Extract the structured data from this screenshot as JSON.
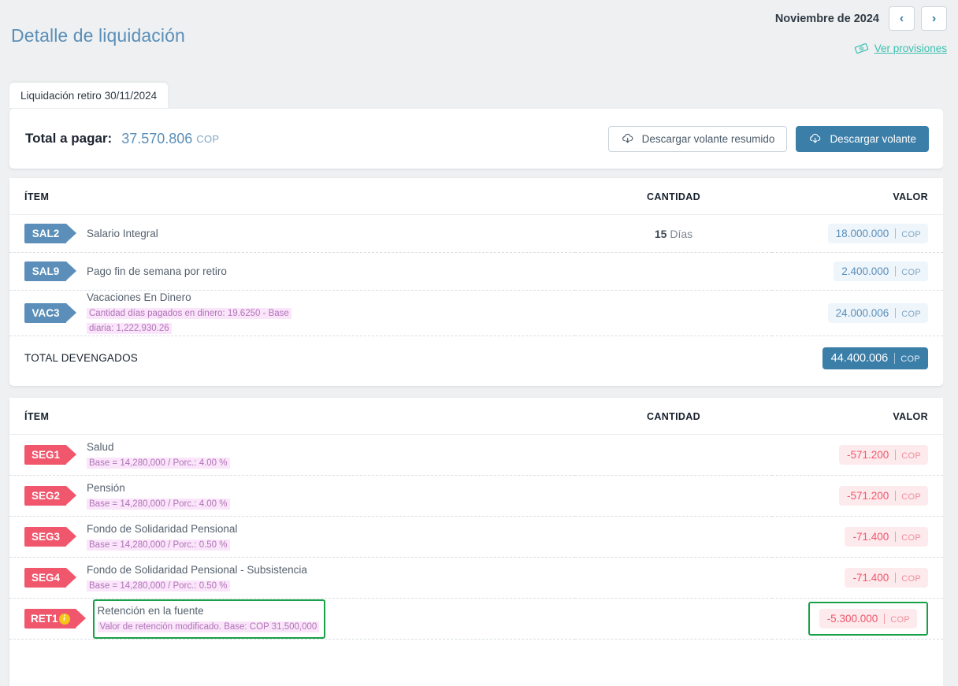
{
  "header": {
    "title": "Detalle de liquidación",
    "month_label": "Noviembre de 2024",
    "prev_icon": "chevron-left-icon",
    "next_icon": "chevron-right-icon",
    "prev_glyph": "‹",
    "next_glyph": "›",
    "provisions_link": "Ver provisiones",
    "provisions_icon": "banknote-icon",
    "accent_title": "#5b8fb9",
    "accent_link": "#3bbfb0"
  },
  "tabs": [
    {
      "label": "Liquidación retiro 30/11/2024",
      "active": true
    }
  ],
  "summary": {
    "total_label": "Total a pagar:",
    "total_value": "37.570.806",
    "currency": "COP",
    "buttons": [
      {
        "label": "Descargar volante resumido",
        "icon": "cloud-download-icon",
        "style": "ghost"
      },
      {
        "label": "Descargar volante",
        "icon": "cloud-download-icon",
        "style": "solid"
      }
    ]
  },
  "columns": {
    "item": "ÍTEM",
    "qty": "CANTIDAD",
    "value": "VALOR"
  },
  "earnings": {
    "rows": [
      {
        "code": "SAL2",
        "name": "Salario Integral",
        "sub": "",
        "qty_number": "15",
        "qty_unit": "Días",
        "value": "18.000.000",
        "currency": "COP",
        "sign": "pos"
      },
      {
        "code": "SAL9",
        "name": "Pago fin de semana por retiro",
        "sub": "",
        "qty_number": "",
        "qty_unit": "",
        "value": "2.400.000",
        "currency": "COP",
        "sign": "pos"
      },
      {
        "code": "VAC3",
        "name": "Vacaciones En Dinero",
        "sub": "Cantidad días pagados en dinero: 19.6250 - Base diaria: 1,222,930.26",
        "qty_number": "",
        "qty_unit": "",
        "value": "24.000.006",
        "currency": "COP",
        "sign": "pos"
      }
    ],
    "total_label": "TOTAL DEVENGADOS",
    "total_value": "44.400.006",
    "total_currency": "COP"
  },
  "deductions": {
    "rows": [
      {
        "code": "SEG1",
        "name": "Salud",
        "sub": "Base = 14,280,000 / Porc.: 4.00 %",
        "qty_number": "",
        "qty_unit": "",
        "value": "-571.200",
        "currency": "COP",
        "sign": "neg",
        "highlight": false
      },
      {
        "code": "SEG2",
        "name": "Pensión",
        "sub": "Base = 14,280,000 / Porc.: 4.00 %",
        "qty_number": "",
        "qty_unit": "",
        "value": "-571.200",
        "currency": "COP",
        "sign": "neg",
        "highlight": false
      },
      {
        "code": "SEG3",
        "name": "Fondo de Solidaridad Pensional",
        "sub": "Base = 14,280,000 / Porc.: 0.50 %",
        "qty_number": "",
        "qty_unit": "",
        "value": "-71.400",
        "currency": "COP",
        "sign": "neg",
        "highlight": false
      },
      {
        "code": "SEG4",
        "name": "Fondo de Solidaridad Pensional - Subsistencia",
        "sub": "Base = 14,280,000 / Porc.: 0.50 %",
        "qty_number": "",
        "qty_unit": "",
        "value": "-71.400",
        "currency": "COP",
        "sign": "neg",
        "highlight": false
      },
      {
        "code": "RET1",
        "name": "Retención en la fuente",
        "sub": "Valor de retención modificado. Base: COP 31,500,000",
        "badge": "i",
        "badge_icon": "info-badge-icon",
        "qty_number": "",
        "qty_unit": "",
        "value": "-5.300.000",
        "currency": "COP",
        "sign": "neg",
        "highlight": true
      }
    ]
  },
  "colors": {
    "tag_blue": "#5b8fb9",
    "tag_red": "#f0576d",
    "highlight_green": "#18a04a",
    "badge_yellow": "#f5c518",
    "sub_highlight": "#fae5fa",
    "page_bg": "#eef0f1"
  }
}
